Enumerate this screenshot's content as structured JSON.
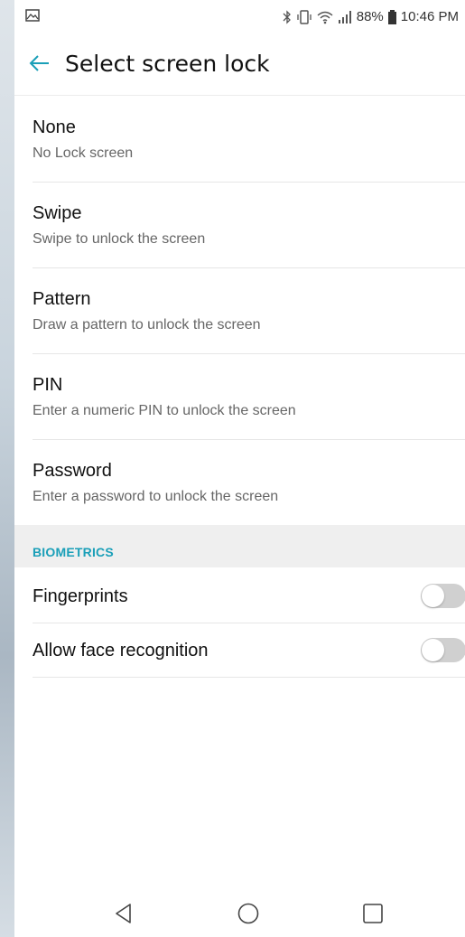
{
  "status_bar": {
    "battery_percent": "88%",
    "time": "10:46 PM",
    "icons": [
      "image-notification-icon",
      "bluetooth-icon",
      "vibrate-icon",
      "wifi-icon",
      "signal-icon",
      "battery-icon"
    ]
  },
  "app_bar": {
    "title": "Select screen lock",
    "back_icon": "back-arrow-icon"
  },
  "options": [
    {
      "title": "None",
      "subtitle": "No Lock screen"
    },
    {
      "title": "Swipe",
      "subtitle": "Swipe to unlock the screen"
    },
    {
      "title": "Pattern",
      "subtitle": "Draw a pattern to unlock the screen"
    },
    {
      "title": "PIN",
      "subtitle": "Enter a numeric PIN to unlock the screen"
    },
    {
      "title": "Password",
      "subtitle": "Enter a password to unlock the screen"
    }
  ],
  "biometrics": {
    "header": "BIOMETRICS",
    "items": [
      {
        "label": "Fingerprints",
        "enabled": false
      },
      {
        "label": "Allow face recognition",
        "enabled": false
      }
    ]
  },
  "colors": {
    "accent": "#1a9fb8",
    "switch_off": "#d0d0d0"
  },
  "nav_bar": {
    "icons": [
      "nav-back-icon",
      "nav-home-icon",
      "nav-recents-icon"
    ]
  }
}
